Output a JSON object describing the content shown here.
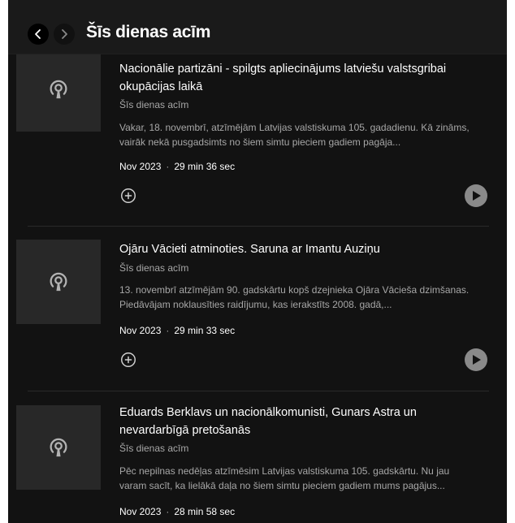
{
  "header": {
    "title": "Šīs dienas acīm",
    "back_icon": "chevron-left-icon",
    "forward_icon": "chevron-right-icon"
  },
  "episodes": [
    {
      "title": "Nacionālie partizāni - spilgts apliecinājums latviešu valstsgribai okupācijas laikā",
      "show": "Šīs dienas acīm",
      "description": "Vakar, 18. novembrī, atzīmējām Latvijas valstiskuma 105. gadadienu. Kā zināms, vairāk nekā pusgadsimts no šiem simtu pieciem gadiem pagāja...",
      "date": "Nov 2023",
      "duration": "29 min 36 sec"
    },
    {
      "title": "Ojāru Vācieti atminoties. Saruna ar Imantu Auziņu",
      "show": "Šīs dienas acīm",
      "description": "13. novembrī atzīmējām 90. gadskārtu kopš dzejnieka Ojāra Vācieša dzimšanas. Piedāvājam noklausīties raidījumu, kas ierakstīts 2008. gadā,...",
      "date": "Nov 2023",
      "duration": "29 min 33 sec"
    },
    {
      "title": "Eduards Berklavs un nacionālkomunisti, Gunars Astra un nevardarbīgā pretošanās",
      "show": "Šīs dienas acīm",
      "description": "Pēc nepilnas nedēļas atzīmēsim Latvijas valstiskuma 105. gadskārtu. Nu jau varam sacīt, ka lielākā daļa no šiem simtu pieciem gadiem mums pagājus...",
      "date": "Nov 2023",
      "duration": "28 min 58 sec"
    }
  ],
  "meta_separator": "·",
  "colors": {
    "background": "#121212",
    "cover": "#282828",
    "text_primary": "#ffffff",
    "text_secondary": "#a7a7a7",
    "play_button": "#8a8a8a"
  }
}
